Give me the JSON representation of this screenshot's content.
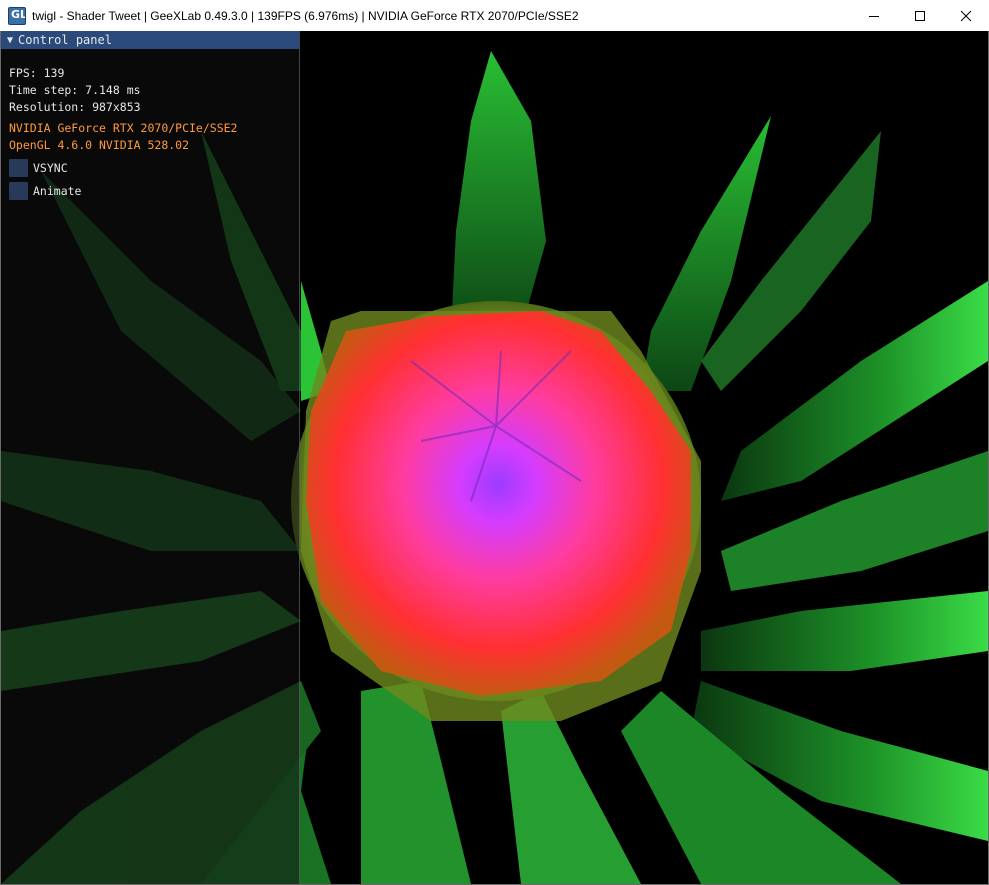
{
  "window": {
    "title": "twigl - Shader Tweet | GeeXLab 0.49.3.0 | 139FPS (6.976ms) | NVIDIA GeForce RTX 2070/PCIe/SSE2",
    "icon": "geexlab-app-icon",
    "buttons": [
      "minimize-icon",
      "maximize-icon",
      "close-icon"
    ]
  },
  "panel": {
    "header_label": "Control panel",
    "fps": "FPS: 139",
    "time_step": "Time step: 7.148 ms",
    "resolution": "Resolution: 987x853",
    "gpu": "NVIDIA GeForce RTX 2070/PCIe/SSE2",
    "opengl": "OpenGL 4.6.0 NVIDIA 528.02",
    "checkboxes": [
      {
        "label": "VSYNC",
        "checked": false
      },
      {
        "label": "Animate",
        "checked": false
      }
    ]
  },
  "colors": {
    "accent_header": "#294a7a",
    "info_orange": "#ff9a3c",
    "checkbox_bg": "#29395a",
    "petal_green": "#2fd23a",
    "bloom_center": "#c040ff",
    "bloom_outer": "#ff3a3a"
  }
}
